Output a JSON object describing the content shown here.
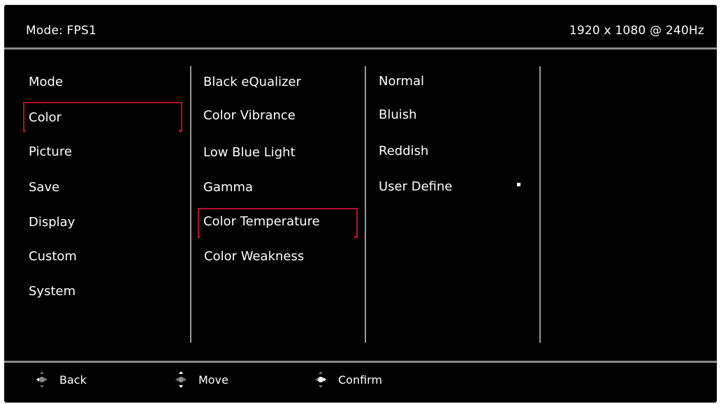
{
  "header": {
    "mode_label": "Mode: FPS1",
    "resolution": "1920 x 1080 @ 240Hz"
  },
  "menu_level1": {
    "items": [
      "Mode",
      "Color",
      "Picture",
      "Save",
      "Display",
      "Custom",
      "System"
    ],
    "selected": "Color"
  },
  "menu_level2": {
    "items": [
      "Black eQualizer",
      "Color Vibrance",
      "Low Blue Light",
      "Gamma",
      "Color Temperature",
      "Color Weakness"
    ],
    "selected": "Color Temperature"
  },
  "menu_level3": {
    "items": [
      "Normal",
      "Bluish",
      "Reddish",
      "User Define"
    ]
  },
  "footer": {
    "back_label": "Back",
    "move_label": "Move",
    "confirm_label": "Confirm"
  },
  "colors": {
    "highlight": "#b80f2e",
    "divider": "#8a8a8a",
    "background": "#000000",
    "text": "#ffffff"
  },
  "icons": {
    "back": "joystick-left-icon",
    "move": "joystick-updown-icon",
    "confirm": "joystick-press-icon"
  }
}
